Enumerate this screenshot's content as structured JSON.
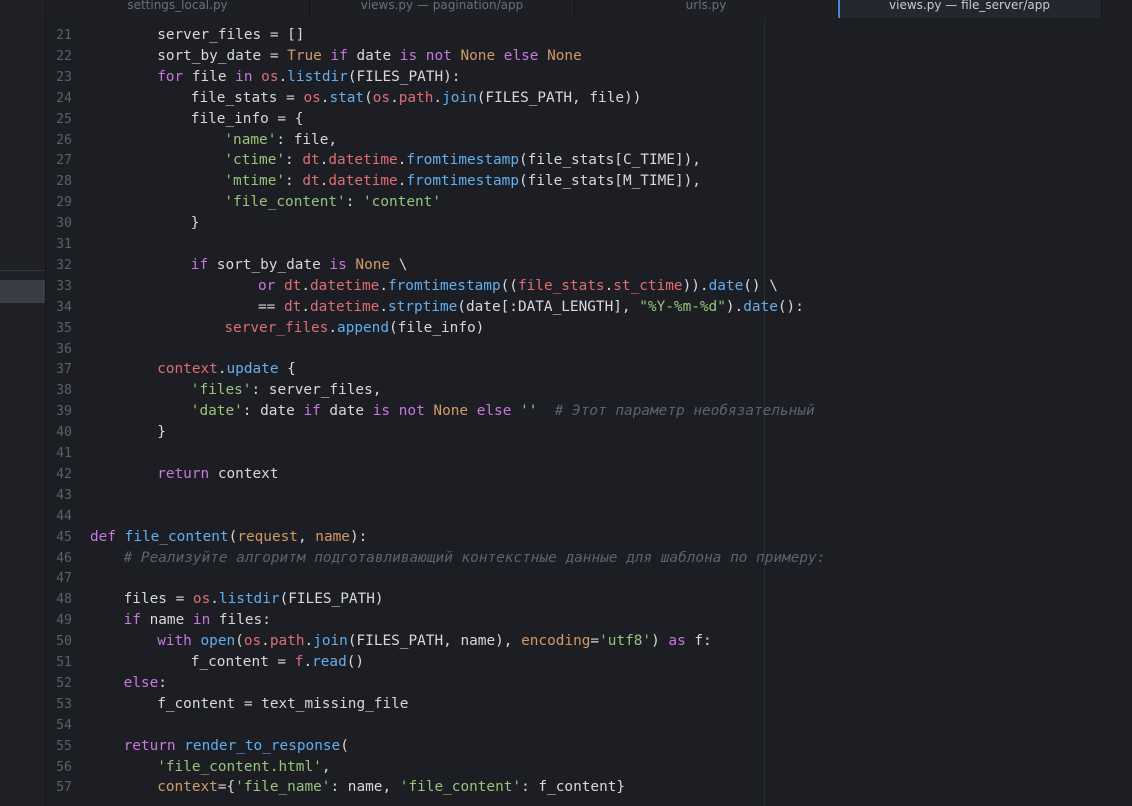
{
  "tabs": [
    {
      "label": "settings_local.py",
      "active": false
    },
    {
      "label": "views.py — pagination/app",
      "active": false
    },
    {
      "label": "urls.py",
      "active": false
    },
    {
      "label": "views.py — file_server/app",
      "active": true
    }
  ],
  "top_line_number": "20",
  "lines": [
    {
      "n": "21",
      "indent": 8,
      "tokens": [
        [
          "t",
          "server_files = []"
        ]
      ]
    },
    {
      "n": "22",
      "indent": 8,
      "tokens": [
        [
          "t",
          "sort_by_date = "
        ],
        [
          "cn",
          "True"
        ],
        [
          "t",
          " "
        ],
        [
          "kw",
          "if"
        ],
        [
          "t",
          " date "
        ],
        [
          "kw",
          "is not"
        ],
        [
          "t",
          " "
        ],
        [
          "cn",
          "None"
        ],
        [
          "t",
          " "
        ],
        [
          "kw",
          "else"
        ],
        [
          "t",
          " "
        ],
        [
          "cn",
          "None"
        ]
      ]
    },
    {
      "n": "23",
      "indent": 8,
      "tokens": [
        [
          "kw",
          "for"
        ],
        [
          "t",
          " file "
        ],
        [
          "kw",
          "in"
        ],
        [
          "t",
          " "
        ],
        [
          "bi",
          "os"
        ],
        [
          "t",
          "."
        ],
        [
          "fn",
          "listdir"
        ],
        [
          "t",
          "(FILES_PATH):"
        ]
      ]
    },
    {
      "n": "24",
      "indent": 12,
      "tokens": [
        [
          "t",
          "file_stats = "
        ],
        [
          "bi",
          "os"
        ],
        [
          "t",
          "."
        ],
        [
          "fn",
          "stat"
        ],
        [
          "t",
          "("
        ],
        [
          "bi",
          "os"
        ],
        [
          "t",
          "."
        ],
        [
          "bi",
          "path"
        ],
        [
          "t",
          "."
        ],
        [
          "fn",
          "join"
        ],
        [
          "t",
          "(FILES_PATH, file))"
        ]
      ]
    },
    {
      "n": "25",
      "indent": 12,
      "tokens": [
        [
          "t",
          "file_info = {"
        ]
      ]
    },
    {
      "n": "26",
      "indent": 16,
      "tokens": [
        [
          "st",
          "'name'"
        ],
        [
          "t",
          ": file,"
        ]
      ]
    },
    {
      "n": "27",
      "indent": 16,
      "tokens": [
        [
          "st",
          "'ctime'"
        ],
        [
          "t",
          ": "
        ],
        [
          "bi",
          "dt"
        ],
        [
          "t",
          "."
        ],
        [
          "bi",
          "datetime"
        ],
        [
          "t",
          "."
        ],
        [
          "fn",
          "fromtimestamp"
        ],
        [
          "t",
          "(file_stats[C_TIME]),"
        ]
      ]
    },
    {
      "n": "28",
      "indent": 16,
      "tokens": [
        [
          "st",
          "'mtime'"
        ],
        [
          "t",
          ": "
        ],
        [
          "bi",
          "dt"
        ],
        [
          "t",
          "."
        ],
        [
          "bi",
          "datetime"
        ],
        [
          "t",
          "."
        ],
        [
          "fn",
          "fromtimestamp"
        ],
        [
          "t",
          "(file_stats[M_TIME]),"
        ]
      ]
    },
    {
      "n": "29",
      "indent": 16,
      "tokens": [
        [
          "st",
          "'file_content'"
        ],
        [
          "t",
          ": "
        ],
        [
          "st",
          "'content'"
        ]
      ]
    },
    {
      "n": "30",
      "indent": 12,
      "tokens": [
        [
          "t",
          "}"
        ]
      ]
    },
    {
      "n": "31",
      "indent": 0,
      "tokens": []
    },
    {
      "n": "32",
      "indent": 12,
      "tokens": [
        [
          "kw",
          "if"
        ],
        [
          "t",
          " sort_by_date "
        ],
        [
          "kw",
          "is"
        ],
        [
          "t",
          " "
        ],
        [
          "cn",
          "None"
        ],
        [
          "t",
          " \\"
        ]
      ]
    },
    {
      "n": "33",
      "indent": 20,
      "tokens": [
        [
          "kw",
          "or"
        ],
        [
          "t",
          " "
        ],
        [
          "bi",
          "dt"
        ],
        [
          "t",
          "."
        ],
        [
          "bi",
          "datetime"
        ],
        [
          "t",
          "."
        ],
        [
          "fn",
          "fromtimestamp"
        ],
        [
          "t",
          "(("
        ],
        [
          "bi",
          "file_stats"
        ],
        [
          "t",
          "."
        ],
        [
          "bi",
          "st_ctime"
        ],
        [
          "t",
          "))."
        ],
        [
          "fn",
          "date"
        ],
        [
          "t",
          "() \\"
        ]
      ]
    },
    {
      "n": "34",
      "indent": 20,
      "tokens": [
        [
          "t",
          "== "
        ],
        [
          "bi",
          "dt"
        ],
        [
          "t",
          "."
        ],
        [
          "bi",
          "datetime"
        ],
        [
          "t",
          "."
        ],
        [
          "fn",
          "strptime"
        ],
        [
          "t",
          "(date[:DATA_LENGTH], "
        ],
        [
          "st",
          "\"%Y-%m-%d\""
        ],
        [
          "t",
          ")."
        ],
        [
          "fn",
          "date"
        ],
        [
          "t",
          "():"
        ]
      ]
    },
    {
      "n": "35",
      "indent": 16,
      "tokens": [
        [
          "bi",
          "server_files"
        ],
        [
          "t",
          "."
        ],
        [
          "fn",
          "append"
        ],
        [
          "t",
          "(file_info)"
        ]
      ]
    },
    {
      "n": "36",
      "indent": 0,
      "tokens": []
    },
    {
      "n": "37",
      "indent": 8,
      "tokens": [
        [
          "bi",
          "context"
        ],
        [
          "t",
          "."
        ],
        [
          "fn",
          "update"
        ],
        [
          "t",
          " {"
        ]
      ]
    },
    {
      "n": "38",
      "indent": 12,
      "tokens": [
        [
          "st",
          "'files'"
        ],
        [
          "t",
          ": server_files,"
        ]
      ]
    },
    {
      "n": "39",
      "indent": 12,
      "tokens": [
        [
          "st",
          "'date'"
        ],
        [
          "t",
          ": date "
        ],
        [
          "kw",
          "if"
        ],
        [
          "t",
          " date "
        ],
        [
          "kw",
          "is not"
        ],
        [
          "t",
          " "
        ],
        [
          "cn",
          "None"
        ],
        [
          "t",
          " "
        ],
        [
          "kw",
          "else"
        ],
        [
          "t",
          " "
        ],
        [
          "st",
          "''"
        ],
        [
          "t",
          "  "
        ],
        [
          "cm",
          "# Этот параметр необязательный"
        ]
      ]
    },
    {
      "n": "40",
      "indent": 8,
      "tokens": [
        [
          "t",
          "}"
        ]
      ]
    },
    {
      "n": "41",
      "indent": 0,
      "tokens": []
    },
    {
      "n": "42",
      "indent": 8,
      "tokens": [
        [
          "kw",
          "return"
        ],
        [
          "t",
          " context"
        ]
      ]
    },
    {
      "n": "43",
      "indent": 0,
      "tokens": []
    },
    {
      "n": "44",
      "indent": 0,
      "tokens": []
    },
    {
      "n": "45",
      "indent": 0,
      "tokens": [
        [
          "kw",
          "def"
        ],
        [
          "t",
          " "
        ],
        [
          "fn",
          "file_content"
        ],
        [
          "t",
          "("
        ],
        [
          "cn",
          "request"
        ],
        [
          "t",
          ", "
        ],
        [
          "cn",
          "name"
        ],
        [
          "t",
          "):"
        ]
      ]
    },
    {
      "n": "46",
      "indent": 4,
      "tokens": [
        [
          "cm",
          "# Реализуйте алгоритм подготавливающий контекстные данные для шаблона по примеру:"
        ]
      ]
    },
    {
      "n": "47",
      "indent": 0,
      "tokens": []
    },
    {
      "n": "48",
      "indent": 4,
      "tokens": [
        [
          "t",
          "files = "
        ],
        [
          "bi",
          "os"
        ],
        [
          "t",
          "."
        ],
        [
          "fn",
          "listdir"
        ],
        [
          "t",
          "(FILES_PATH)"
        ]
      ]
    },
    {
      "n": "49",
      "indent": 4,
      "tokens": [
        [
          "kw",
          "if"
        ],
        [
          "t",
          " name "
        ],
        [
          "kw",
          "in"
        ],
        [
          "t",
          " files:"
        ]
      ]
    },
    {
      "n": "50",
      "indent": 8,
      "tokens": [
        [
          "kw",
          "with"
        ],
        [
          "t",
          " "
        ],
        [
          "fn",
          "open"
        ],
        [
          "t",
          "("
        ],
        [
          "bi",
          "os"
        ],
        [
          "t",
          "."
        ],
        [
          "bi",
          "path"
        ],
        [
          "t",
          "."
        ],
        [
          "fn",
          "join"
        ],
        [
          "t",
          "(FILES_PATH, name), "
        ],
        [
          "cn",
          "encoding"
        ],
        [
          "t",
          "="
        ],
        [
          "st",
          "'utf8'"
        ],
        [
          "t",
          ") "
        ],
        [
          "kw",
          "as"
        ],
        [
          "t",
          " f:"
        ]
      ]
    },
    {
      "n": "51",
      "indent": 12,
      "tokens": [
        [
          "t",
          "f_content = "
        ],
        [
          "bi",
          "f"
        ],
        [
          "t",
          "."
        ],
        [
          "fn",
          "read"
        ],
        [
          "t",
          "()"
        ]
      ]
    },
    {
      "n": "52",
      "indent": 4,
      "tokens": [
        [
          "kw",
          "else"
        ],
        [
          "t",
          ":"
        ]
      ]
    },
    {
      "n": "53",
      "indent": 8,
      "tokens": [
        [
          "t",
          "f_content = text_missing_file"
        ]
      ]
    },
    {
      "n": "54",
      "indent": 0,
      "tokens": []
    },
    {
      "n": "55",
      "indent": 4,
      "tokens": [
        [
          "kw",
          "return"
        ],
        [
          "t",
          " "
        ],
        [
          "fn",
          "render_to_response"
        ],
        [
          "t",
          "("
        ]
      ]
    },
    {
      "n": "56",
      "indent": 8,
      "tokens": [
        [
          "st",
          "'file_content.html'"
        ],
        [
          "t",
          ","
        ]
      ]
    },
    {
      "n": "57",
      "indent": 8,
      "tokens": [
        [
          "cn",
          "context"
        ],
        [
          "t",
          "={"
        ],
        [
          "st",
          "'file_name'"
        ],
        [
          "t",
          ": name, "
        ],
        [
          "st",
          "'file_content'"
        ],
        [
          "t",
          ": f_content}"
        ]
      ]
    }
  ]
}
